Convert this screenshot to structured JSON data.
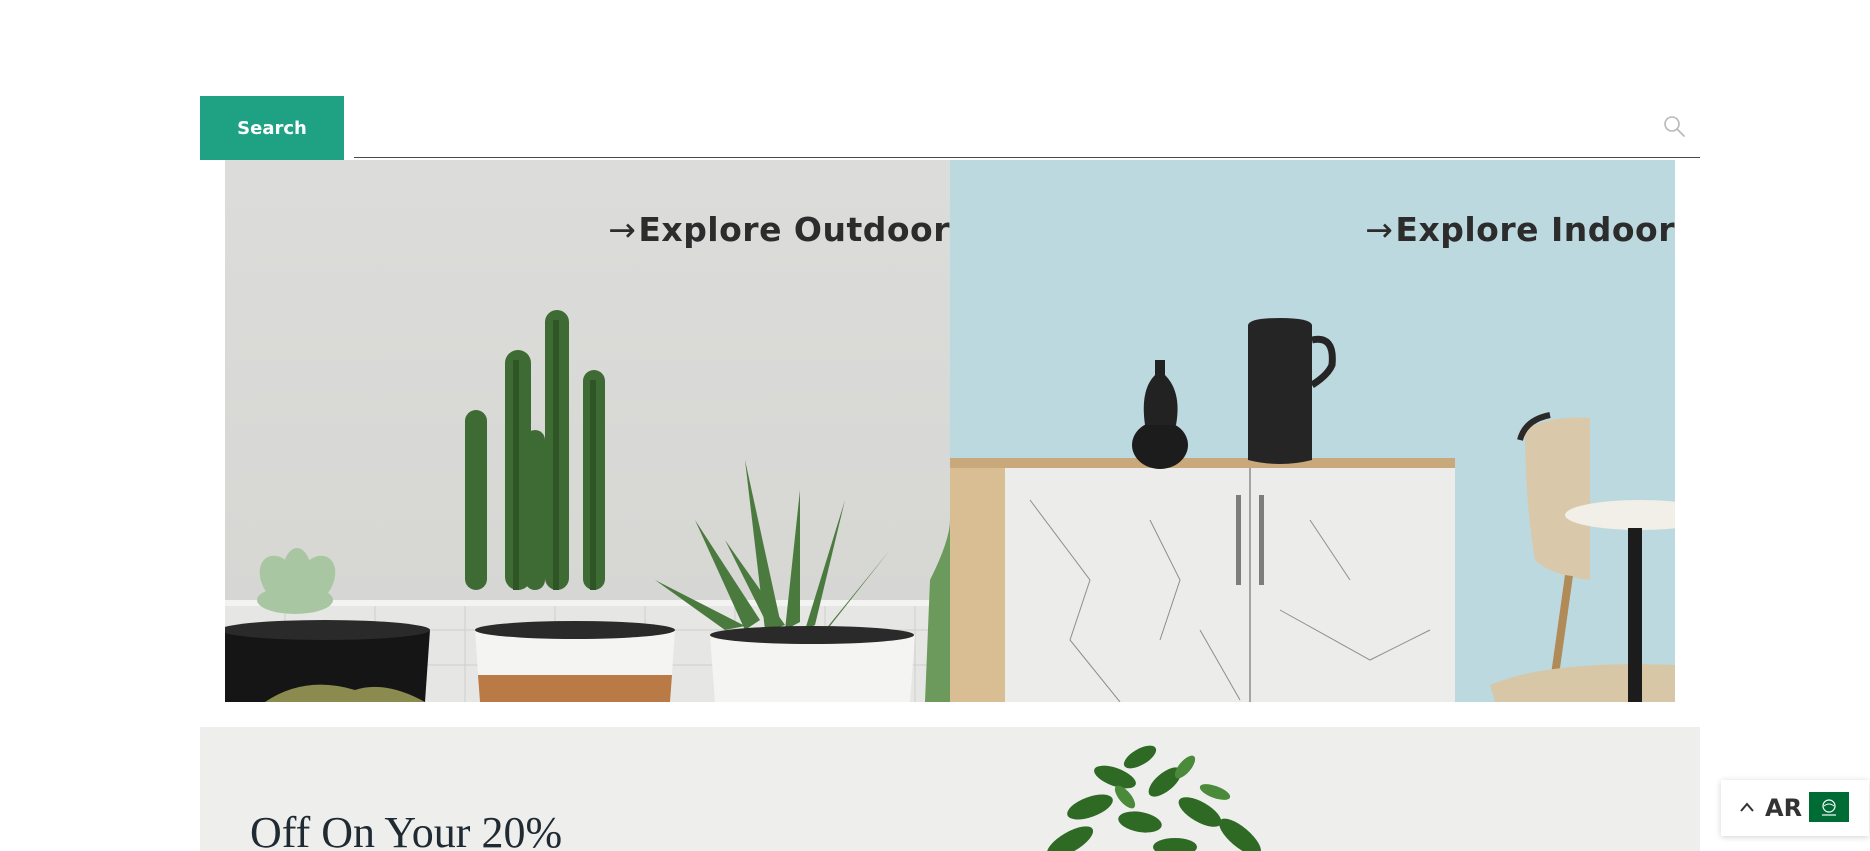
{
  "search": {
    "button_label": "Search",
    "input_value": "",
    "placeholder": ""
  },
  "explore": [
    {
      "label": "Explore Outdoor",
      "arrow": "→"
    },
    {
      "label": "Explore Indoor",
      "arrow": "→"
    }
  ],
  "promo": {
    "title": "Off On Your 20%"
  },
  "language": {
    "code": "AR",
    "flag_icon": "saudi-flag-icon"
  },
  "colors": {
    "accent": "#1fa184",
    "outdoor_bg": "#d8d8d6",
    "indoor_bg": "#bcd9df",
    "promo_bg": "#eeefed",
    "flag_green": "#006c35"
  }
}
